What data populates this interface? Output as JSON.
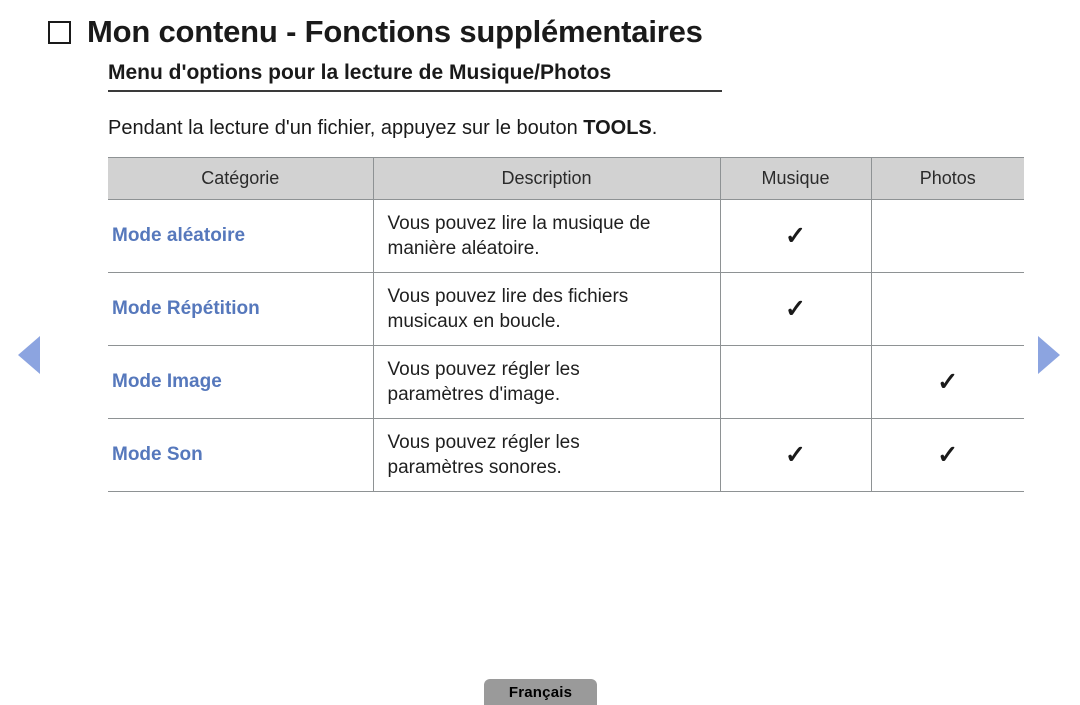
{
  "page": {
    "title": "Mon contenu - Fonctions supplémentaires",
    "subtitle": "Menu d'options pour la lecture de Musique/Photos",
    "intro_before": "Pendant la lecture d'un fichier, appuyez sur le bouton ",
    "intro_bold": "TOOLS",
    "intro_after": "."
  },
  "nav": {
    "prev_icon": "triangle-left-icon",
    "next_icon": "triangle-right-icon",
    "arrow_color": "#8ca4e0"
  },
  "table": {
    "headers": [
      "Catégorie",
      "Description",
      "Musique",
      "Photos"
    ],
    "header_bg": "#d2d2d2",
    "category_color": "#5678bc",
    "check_glyph": "✓",
    "rows": [
      {
        "category": "Mode aléatoire",
        "description_line1": "Vous pouvez lire la musique de",
        "description_line2": "manière aléatoire.",
        "musique": true,
        "photos": false
      },
      {
        "category": "Mode Répétition",
        "description_line1": "Vous pouvez lire des fichiers",
        "description_line2": "musicaux en boucle.",
        "musique": true,
        "photos": false
      },
      {
        "category": "Mode Image",
        "description_line1": "Vous pouvez régler les",
        "description_line2": "paramètres d'image.",
        "musique": false,
        "photos": true
      },
      {
        "category": "Mode Son",
        "description_line1": "Vous pouvez régler les",
        "description_line2": "paramètres sonores.",
        "musique": true,
        "photos": true
      }
    ]
  },
  "footer": {
    "language": "Français"
  }
}
